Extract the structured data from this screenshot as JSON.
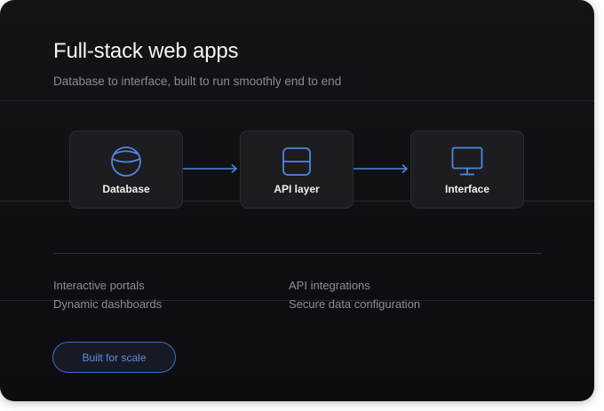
{
  "header": {
    "title": "Full-stack web apps",
    "subtitle": "Database to interface, built to run smoothly end to end"
  },
  "flow": {
    "nodes": [
      {
        "label": "Database",
        "icon": "database-icon"
      },
      {
        "label": "API layer",
        "icon": "api-layer-icon"
      },
      {
        "label": "Interface",
        "icon": "monitor-icon"
      }
    ]
  },
  "features": {
    "left": [
      "Interactive portals",
      "Dynamic dashboards"
    ],
    "right": [
      "API integrations",
      "Secure data configuration"
    ]
  },
  "cta": {
    "label": "Built for scale"
  },
  "colors": {
    "accent": "#4f86dd",
    "background": "#111115",
    "node_background": "#1c1c21"
  }
}
